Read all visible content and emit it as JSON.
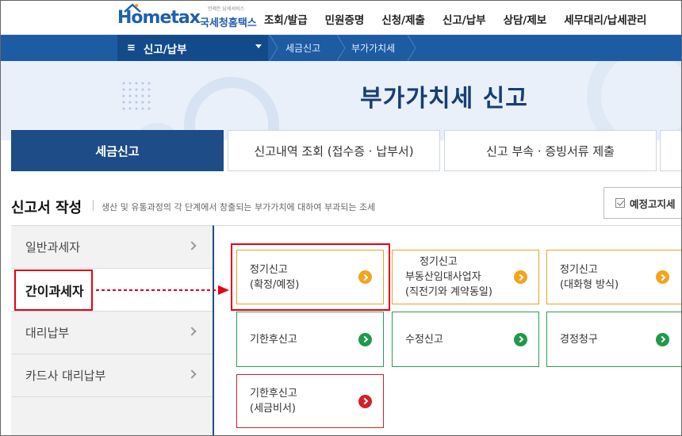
{
  "header": {
    "logo_text": "Hometax",
    "logo_tagline": "언제든 납세서비스",
    "logo_sub": "국세청홈택스",
    "gnb": [
      "조회/발급",
      "민원증명",
      "신청/제출",
      "신고/납부",
      "상담/제보",
      "세무대리/납세관리"
    ]
  },
  "navbar": {
    "menu_label": "신고/납부",
    "breadcrumb": [
      "세금신고",
      "부가가치세"
    ]
  },
  "hero": {
    "title": "부가가치세 신고"
  },
  "tabs": [
    {
      "label": "세금신고",
      "active": true
    },
    {
      "label": "신고내역 조회 (접수증 · 납부서)",
      "active": false
    },
    {
      "label": "신고 부속 · 증빙서류 제출",
      "active": false
    }
  ],
  "section": {
    "title": "신고서 작성",
    "description": "생산 및 유통과정의 각 단계에서 창출되는 부가가치에 대하여 부과되는 조세",
    "notice_button": "예정고지세"
  },
  "left_menu": [
    {
      "label": "일반과세자",
      "active": false
    },
    {
      "label": "간이과세자",
      "active": true
    },
    {
      "label": "대리납부",
      "active": false
    },
    {
      "label": "카드사 대리납부",
      "active": false
    }
  ],
  "cards": {
    "regular": {
      "line1": "정기신고",
      "line2": "(확정/예정)"
    },
    "real_estate": {
      "line1": "정기신고",
      "line2": "부동산임대사업자",
      "line3": "(직전기와 계약동일)"
    },
    "interactive": {
      "line1": "정기신고",
      "line2": "(대화형 방식)"
    },
    "late": {
      "line1": "기한후신고"
    },
    "amended": {
      "line1": "수정신고"
    },
    "correction": {
      "line1": "경정청구"
    },
    "late_secret": {
      "line1": "기한후신고",
      "line2": "(세금비서)"
    }
  },
  "colors": {
    "brand_blue": "#1d5ba3",
    "tab_active": "#1e4c86",
    "card_orange": "#e6a22c",
    "card_green": "#2e9a57",
    "card_red": "#c8242b",
    "highlight_red": "#e60012"
  }
}
